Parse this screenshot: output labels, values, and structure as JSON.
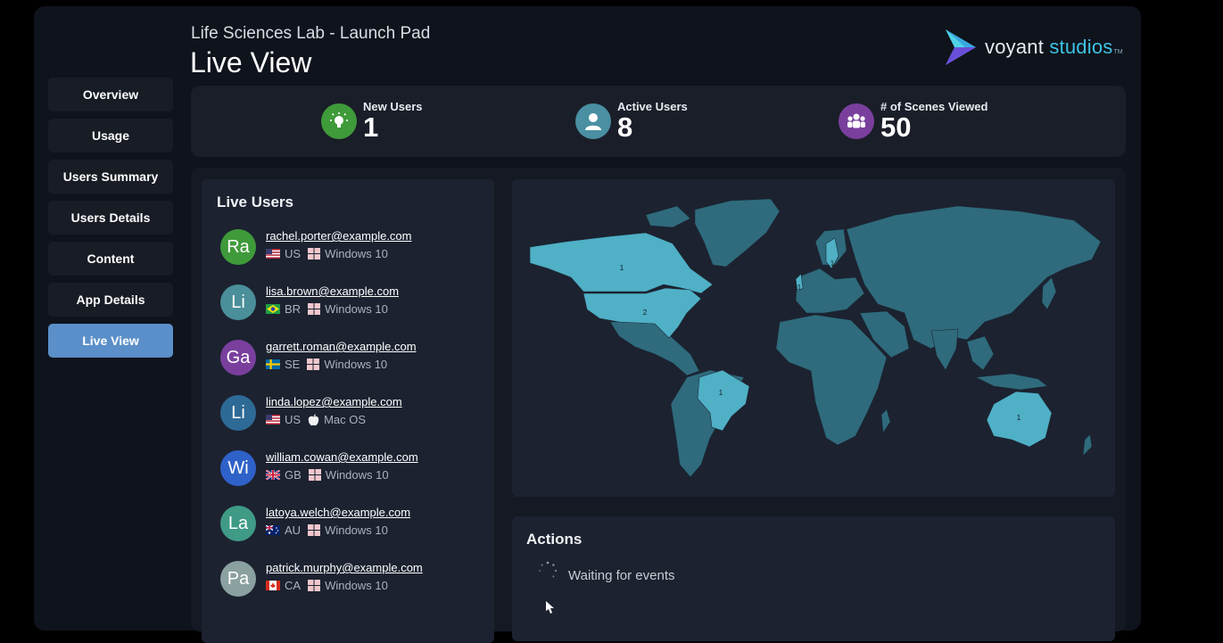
{
  "header": {
    "subtitle": "Life Sciences Lab - Launch Pad",
    "title": "Live View",
    "logo": {
      "name": "voyant",
      "accent": "studios",
      "tm": "TM"
    }
  },
  "nav": {
    "items": [
      "Overview",
      "Usage",
      "Users Summary",
      "Users Details",
      "Content",
      "App Details",
      "Live View"
    ],
    "active": "Live View"
  },
  "stats": [
    {
      "label": "New Users",
      "value": "1",
      "icon": "lightbulb-icon",
      "color": "#3f9a3a"
    },
    {
      "label": "Active Users",
      "value": "8",
      "icon": "user-icon",
      "color": "#4a8fa2"
    },
    {
      "label": "# of Scenes Viewed",
      "value": "50",
      "icon": "group-icon",
      "color": "#7a3f9d"
    }
  ],
  "live_users": {
    "title": "Live Users",
    "users": [
      {
        "initials": "Ra",
        "email": "rachel.porter@example.com",
        "country": "US",
        "os": "Windows 10",
        "avatar_color": "#3f9a3a"
      },
      {
        "initials": "Li",
        "email": "lisa.brown@example.com",
        "country": "BR",
        "os": "Windows 10",
        "avatar_color": "#4a8f99"
      },
      {
        "initials": "Ga",
        "email": "garrett.roman@example.com",
        "country": "SE",
        "os": "Windows 10",
        "avatar_color": "#7a3f9d"
      },
      {
        "initials": "Li",
        "email": "linda.lopez@example.com",
        "country": "US",
        "os": "Mac OS",
        "avatar_color": "#2e6a96"
      },
      {
        "initials": "Wi",
        "email": "william.cowan@example.com",
        "country": "GB",
        "os": "Windows 10",
        "avatar_color": "#2f62c8"
      },
      {
        "initials": "La",
        "email": "latoya.welch@example.com",
        "country": "AU",
        "os": "Windows 10",
        "avatar_color": "#3f9a86"
      },
      {
        "initials": "Pa",
        "email": "patrick.murphy@example.com",
        "country": "CA",
        "os": "Windows 10",
        "avatar_color": "#8ba0a0"
      }
    ]
  },
  "map": {
    "counts": {
      "canada": "1",
      "usa": "2",
      "sweden": "1",
      "uk": "1",
      "brazil": "1",
      "australia": "1"
    },
    "highlight_color": "#4fb0c6",
    "base_color": "#2f6b7d"
  },
  "actions": {
    "title": "Actions",
    "status": "Waiting for events"
  }
}
